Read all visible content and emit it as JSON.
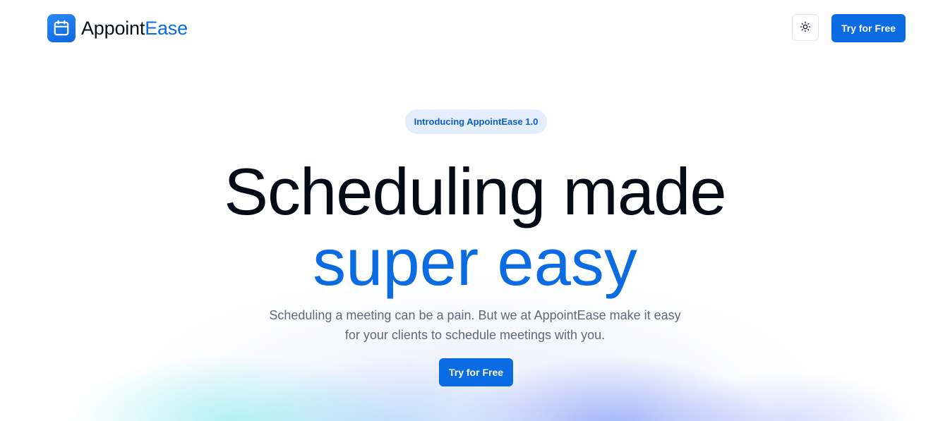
{
  "header": {
    "brand": {
      "name_main": "Appoint",
      "name_accent": "Ease",
      "icon": "calendar-icon"
    },
    "theme_toggle_icon": "sun-icon",
    "cta_label": "Try for Free"
  },
  "hero": {
    "badge": "Introducing AppointEase 1.0",
    "headline_line1": "Scheduling made",
    "headline_line2": "super easy",
    "subtext": "Scheduling a meeting can be a pain. But we at AppointEase make it easy for your clients to schedule meetings with you.",
    "cta_label": "Try for Free"
  },
  "colors": {
    "accent": "#0b6be2",
    "text_dark": "#050a17",
    "text_muted": "#5f6876",
    "badge_bg": "#e3edfb"
  }
}
